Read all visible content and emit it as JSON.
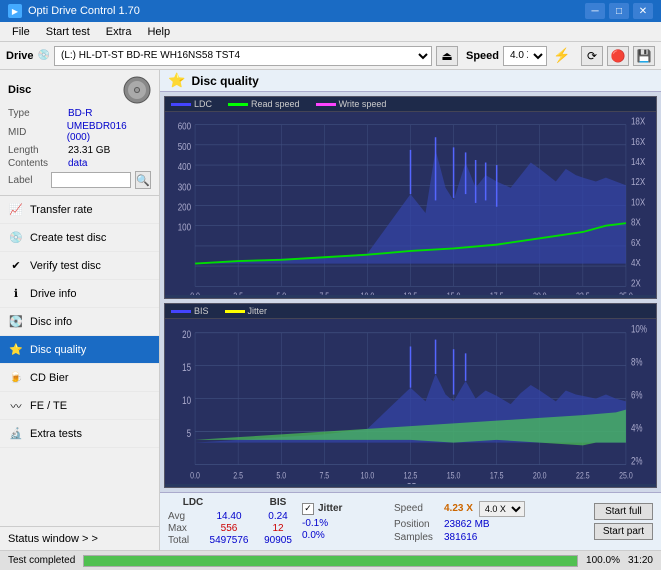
{
  "app": {
    "title": "Opti Drive Control 1.70",
    "title_icon": "disc"
  },
  "title_bar": {
    "title": "Opti Drive Control 1.70",
    "minimize": "─",
    "maximize": "□",
    "close": "✕"
  },
  "menu": {
    "items": [
      "File",
      "Start test",
      "Extra",
      "Help"
    ]
  },
  "drive": {
    "label": "Drive",
    "value": "(L:)  HL-DT-ST BD-RE  WH16NS58 TST4",
    "speed_label": "Speed",
    "speed_value": "4.0 X"
  },
  "disc": {
    "section_title": "Disc",
    "type_label": "Type",
    "type_value": "BD-R",
    "mid_label": "MID",
    "mid_value": "UMEBDR016 (000)",
    "length_label": "Length",
    "length_value": "23.31 GB",
    "contents_label": "Contents",
    "contents_value": "data",
    "label_label": "Label",
    "label_value": ""
  },
  "nav": {
    "items": [
      {
        "id": "transfer-rate",
        "label": "Transfer rate",
        "icon": "chart"
      },
      {
        "id": "create-test-disc",
        "label": "Create test disc",
        "icon": "disc-create"
      },
      {
        "id": "verify-test-disc",
        "label": "Verify test disc",
        "icon": "verify"
      },
      {
        "id": "drive-info",
        "label": "Drive info",
        "icon": "info"
      },
      {
        "id": "disc-info",
        "label": "Disc info",
        "icon": "disc-info"
      },
      {
        "id": "disc-quality",
        "label": "Disc quality",
        "icon": "quality",
        "active": true
      },
      {
        "id": "cd-bier",
        "label": "CD Bier",
        "icon": "cd"
      },
      {
        "id": "fe-te",
        "label": "FE / TE",
        "icon": "fe-te"
      },
      {
        "id": "extra-tests",
        "label": "Extra tests",
        "icon": "extra"
      }
    ],
    "status_window": "Status window > >"
  },
  "content": {
    "header": "Disc quality",
    "chart1": {
      "title": "LDC chart",
      "legend": [
        {
          "label": "LDC",
          "color": "#4444ff"
        },
        {
          "label": "Read speed",
          "color": "#00ff00"
        },
        {
          "label": "Write speed",
          "color": "#ff44ff"
        }
      ],
      "y_max": 600,
      "y_right_max": "18X",
      "x_max": 25,
      "x_label": "GB",
      "x_ticks": [
        "0.0",
        "2.5",
        "5.0",
        "7.5",
        "10.0",
        "12.5",
        "15.0",
        "17.5",
        "20.0",
        "22.5",
        "25.0"
      ],
      "y_right_labels": [
        "18X",
        "16X",
        "14X",
        "12X",
        "10X",
        "8X",
        "6X",
        "4X",
        "2X"
      ]
    },
    "chart2": {
      "title": "BIS/Jitter chart",
      "legend": [
        {
          "label": "BIS",
          "color": "#4444ff"
        },
        {
          "label": "Jitter",
          "color": "#ffff00"
        }
      ],
      "y_max": 20,
      "y_right_max": "10%",
      "x_max": 25,
      "x_label": "GB",
      "x_ticks": [
        "0.0",
        "2.5",
        "5.0",
        "7.5",
        "10.0",
        "12.5",
        "15.0",
        "17.5",
        "20.0",
        "22.5",
        "25.0"
      ],
      "y_right_labels": [
        "10%",
        "8%",
        "6%",
        "4%",
        "2%"
      ],
      "y_left_labels": [
        "20",
        "15",
        "10",
        "5"
      ]
    },
    "stats": {
      "ldc_label": "LDC",
      "bis_label": "BIS",
      "jitter_label": "Jitter",
      "speed_label": "Speed",
      "avg_label": "Avg",
      "max_label": "Max",
      "total_label": "Total",
      "ldc_avg": "14.40",
      "ldc_max": "556",
      "ldc_total": "5497576",
      "bis_avg": "0.24",
      "bis_max": "12",
      "bis_total": "90905",
      "jitter_avg": "-0.1%",
      "jitter_max": "0.0%",
      "jitter_total": "",
      "speed_val": "4.23 X",
      "speed_select": "4.0 X",
      "position_label": "Position",
      "position_val": "23862 MB",
      "samples_label": "Samples",
      "samples_val": "381616",
      "start_full": "Start full",
      "start_part": "Start part"
    }
  },
  "status": {
    "test_complete": "Test completed",
    "progress": 100,
    "progress_text": "100.0%",
    "time": "31:20"
  }
}
